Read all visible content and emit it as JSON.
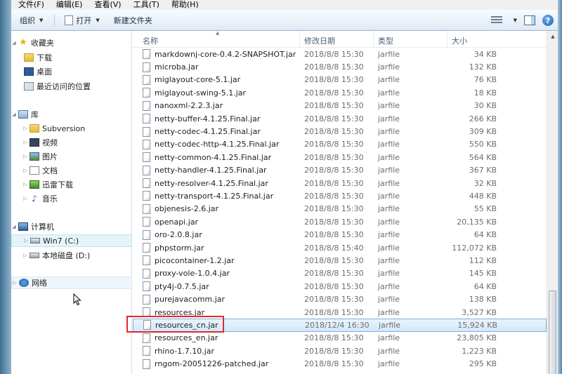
{
  "menu": [
    "文件(F)",
    "编辑(E)",
    "查看(V)",
    "工具(T)",
    "帮助(H)"
  ],
  "toolbar": {
    "organize": "组织",
    "open": "打开",
    "new_folder": "新建文件夹"
  },
  "nav": {
    "favorites": "收藏夹",
    "downloads": "下载",
    "desktop": "桌面",
    "recent": "最近访问的位置",
    "libraries": "库",
    "subversion": "Subversion",
    "videos": "视频",
    "pictures": "图片",
    "documents": "文档",
    "thunder": "迅雷下载",
    "music": "音乐",
    "computer": "计算机",
    "win7": "Win7 (C:)",
    "local_disk": "本地磁盘 (D:)",
    "network": "网络"
  },
  "columns": {
    "name": "名称",
    "date": "修改日期",
    "type": "类型",
    "size": "大小"
  },
  "files": [
    {
      "name": "markdownj-core-0.4.2-SNAPSHOT.jar",
      "date": "2018/8/8 15:30",
      "type": "jarfile",
      "size": "34 KB"
    },
    {
      "name": "microba.jar",
      "date": "2018/8/8 15:30",
      "type": "jarfile",
      "size": "132 KB"
    },
    {
      "name": "miglayout-core-5.1.jar",
      "date": "2018/8/8 15:30",
      "type": "jarfile",
      "size": "76 KB"
    },
    {
      "name": "miglayout-swing-5.1.jar",
      "date": "2018/8/8 15:30",
      "type": "jarfile",
      "size": "18 KB"
    },
    {
      "name": "nanoxml-2.2.3.jar",
      "date": "2018/8/8 15:30",
      "type": "jarfile",
      "size": "30 KB"
    },
    {
      "name": "netty-buffer-4.1.25.Final.jar",
      "date": "2018/8/8 15:30",
      "type": "jarfile",
      "size": "266 KB"
    },
    {
      "name": "netty-codec-4.1.25.Final.jar",
      "date": "2018/8/8 15:30",
      "type": "jarfile",
      "size": "309 KB"
    },
    {
      "name": "netty-codec-http-4.1.25.Final.jar",
      "date": "2018/8/8 15:30",
      "type": "jarfile",
      "size": "550 KB"
    },
    {
      "name": "netty-common-4.1.25.Final.jar",
      "date": "2018/8/8 15:30",
      "type": "jarfile",
      "size": "564 KB"
    },
    {
      "name": "netty-handler-4.1.25.Final.jar",
      "date": "2018/8/8 15:30",
      "type": "jarfile",
      "size": "367 KB"
    },
    {
      "name": "netty-resolver-4.1.25.Final.jar",
      "date": "2018/8/8 15:30",
      "type": "jarfile",
      "size": "32 KB"
    },
    {
      "name": "netty-transport-4.1.25.Final.jar",
      "date": "2018/8/8 15:30",
      "type": "jarfile",
      "size": "448 KB"
    },
    {
      "name": "objenesis-2.6.jar",
      "date": "2018/8/8 15:30",
      "type": "jarfile",
      "size": "55 KB"
    },
    {
      "name": "openapi.jar",
      "date": "2018/8/8 15:30",
      "type": "jarfile",
      "size": "20,135 KB"
    },
    {
      "name": "oro-2.0.8.jar",
      "date": "2018/8/8 15:30",
      "type": "jarfile",
      "size": "64 KB"
    },
    {
      "name": "phpstorm.jar",
      "date": "2018/8/8 15:40",
      "type": "jarfile",
      "size": "112,072 KB"
    },
    {
      "name": "picocontainer-1.2.jar",
      "date": "2018/8/8 15:30",
      "type": "jarfile",
      "size": "112 KB"
    },
    {
      "name": "proxy-vole-1.0.4.jar",
      "date": "2018/8/8 15:30",
      "type": "jarfile",
      "size": "145 KB"
    },
    {
      "name": "pty4j-0.7.5.jar",
      "date": "2018/8/8 15:30",
      "type": "jarfile",
      "size": "64 KB"
    },
    {
      "name": "purejavacomm.jar",
      "date": "2018/8/8 15:30",
      "type": "jarfile",
      "size": "138 KB"
    },
    {
      "name": "resources.jar",
      "date": "2018/8/8 15:30",
      "type": "jarfile",
      "size": "3,527 KB"
    },
    {
      "name": "resources_cn.jar",
      "date": "2018/12/4 16:30",
      "type": "jarfile",
      "size": "15,924 KB"
    },
    {
      "name": "resources_en.jar",
      "date": "2018/8/8 15:30",
      "type": "jarfile",
      "size": "23,805 KB"
    },
    {
      "name": "rhino-1.7.10.jar",
      "date": "2018/8/8 15:30",
      "type": "jarfile",
      "size": "1,223 KB"
    },
    {
      "name": "rngom-20051226-patched.jar",
      "date": "2018/8/8 15:30",
      "type": "jarfile",
      "size": "295 KB"
    }
  ],
  "selected_file": "resources_cn.jar"
}
